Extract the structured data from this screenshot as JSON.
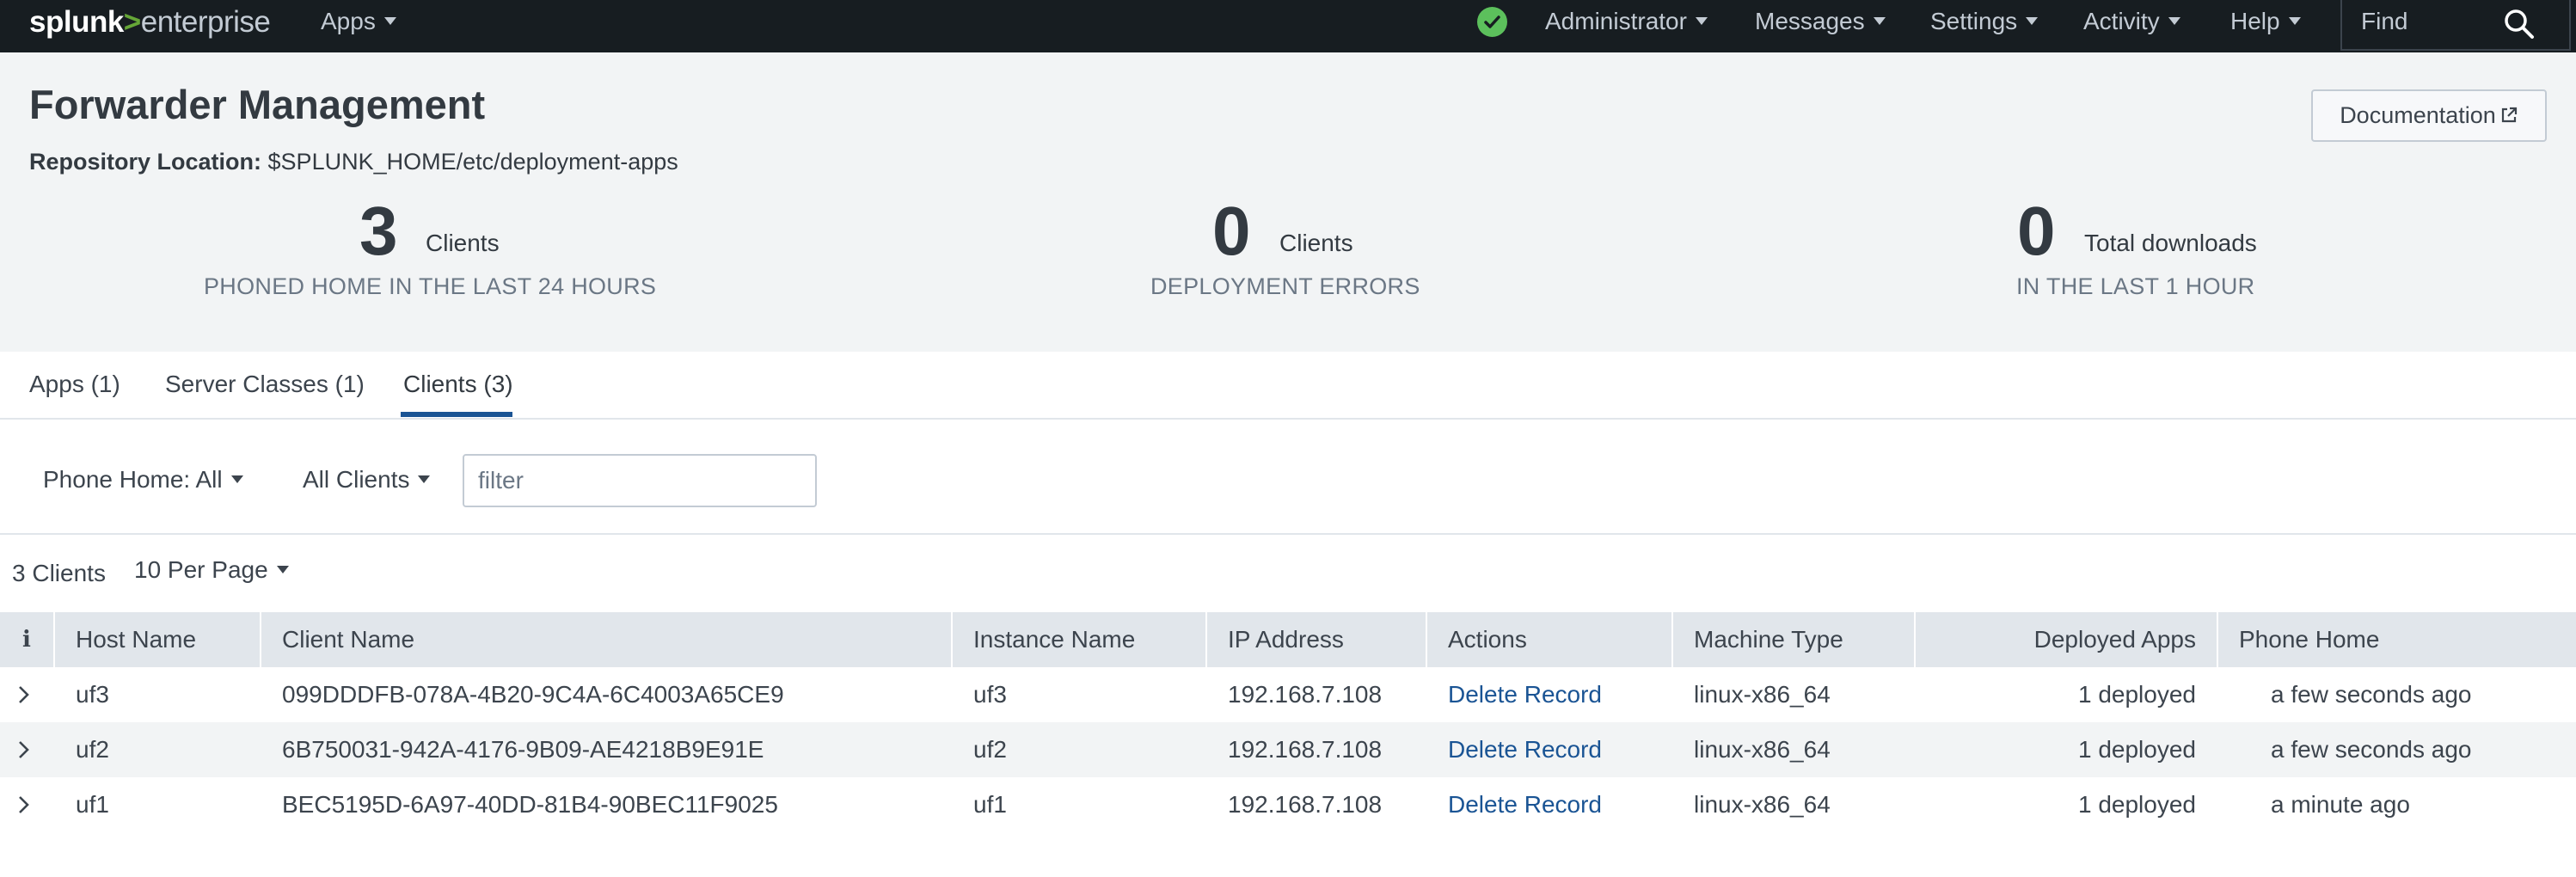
{
  "topnav": {
    "logo": {
      "part1": "splunk",
      "part2": ">",
      "part3": "enterprise"
    },
    "apps_label": "Apps",
    "health_icon": "check-circle-icon",
    "health_color": "#5cc05c",
    "menus": [
      "Administrator",
      "Messages",
      "Settings",
      "Activity",
      "Help"
    ],
    "find_label": "Find",
    "find_icon": "search-icon"
  },
  "header": {
    "title": "Forwarder Management",
    "repo_label": "Repository Location:",
    "repo_path": "$SPLUNK_HOME/etc/deployment-apps",
    "documentation_label": "Documentation",
    "documentation_icon": "external-link-icon",
    "stats": [
      {
        "number": "3",
        "unit": "Clients",
        "caption": "PHONED HOME IN THE LAST 24 HOURS"
      },
      {
        "number": "0",
        "unit": "Clients",
        "caption": "DEPLOYMENT ERRORS"
      },
      {
        "number": "0",
        "unit": "Total downloads",
        "caption": "IN THE LAST 1 HOUR"
      }
    ]
  },
  "tabs": [
    {
      "label": "Apps (1)",
      "active": false
    },
    {
      "label": "Server Classes (1)",
      "active": false
    },
    {
      "label": "Clients (3)",
      "active": true
    }
  ],
  "filters": {
    "phone_home": "Phone Home: All",
    "clients": "All Clients",
    "filter_placeholder": "filter"
  },
  "listing": {
    "count": "3 Clients",
    "per_page": "10 Per Page"
  },
  "table": {
    "info_icon": "info-icon",
    "columns": [
      "Host Name",
      "Client Name",
      "Instance Name",
      "IP Address",
      "Actions",
      "Machine Type",
      "Deployed Apps",
      "Phone Home"
    ],
    "rows": [
      {
        "host": "uf3",
        "client": "099DDDFB-078A-4B20-9C4A-6C4003A65CE9",
        "instance": "uf3",
        "ip": "192.168.7.108",
        "action": "Delete Record",
        "machine": "linux-x86_64",
        "deployed": "1 deployed",
        "phone_home": "a few seconds ago"
      },
      {
        "host": "uf2",
        "client": "6B750031-942A-4176-9B09-AE4218B9E91E",
        "instance": "uf2",
        "ip": "192.168.7.108",
        "action": "Delete Record",
        "machine": "linux-x86_64",
        "deployed": "1 deployed",
        "phone_home": "a few seconds ago"
      },
      {
        "host": "uf1",
        "client": "BEC5195D-6A97-40DD-81B4-90BEC11F9025",
        "instance": "uf1",
        "ip": "192.168.7.108",
        "action": "Delete Record",
        "machine": "linux-x86_64",
        "deployed": "1 deployed",
        "phone_home": "a minute ago"
      }
    ]
  },
  "colors": {
    "nav_bg": "#171d21",
    "brand_green": "#65a637",
    "link_blue": "#1a5494",
    "header_bg": "#f2f4f5"
  }
}
